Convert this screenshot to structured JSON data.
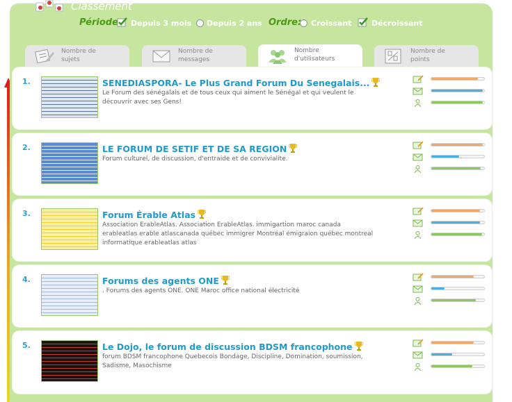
{
  "header": {
    "title": "Classement"
  },
  "filters": {
    "periode_label": "Période:",
    "periode_options": [
      {
        "label": "Depuis 3 mois",
        "selected": true
      },
      {
        "label": "Depuis 2 ans",
        "selected": false
      }
    ],
    "ordre_label": "Ordre:",
    "ordre_options": [
      {
        "label": "Croissant",
        "selected": false
      },
      {
        "label": "Décroissant",
        "selected": true
      }
    ]
  },
  "tabs": [
    {
      "label": "Nombre de sujets",
      "icon": "edit-note-icon",
      "active": false
    },
    {
      "label": "Nombre de messages",
      "icon": "envelope-icon",
      "active": false
    },
    {
      "label": "Nombre d'utilisateurs",
      "icon": "users-icon",
      "active": true
    },
    {
      "label": "Nombre de points",
      "icon": "score-10-10-icon",
      "active": false
    }
  ],
  "forums": [
    {
      "rank": "1.",
      "name": "SENEDIASPORA- Le Plus Grand Forum Du Senegalais...",
      "desc_lines": [
        "Le Forum des sénégalais et de tous ceux qui aiment le Sénégal et qui veulent le",
        "découvrir avec ses Gens!"
      ],
      "stats": {
        "sujets": 0.88,
        "messages": 0.98,
        "utilisateurs": 0.98
      }
    },
    {
      "rank": "2.",
      "name": "LE FORUM DE SETIF ET DE SA REGION",
      "desc_lines": [
        "Forum culturel, de discussion, d'entraide et de convivialite."
      ],
      "stats": {
        "sujets": 0.98,
        "messages": 0.52,
        "utilisateurs": 0.94
      }
    },
    {
      "rank": "3.",
      "name": "Forum Érable Atlas",
      "desc_lines": [
        "Association ErableAtlas. Association ErableAtlas. immigartion maroc canada",
        "erableatlas erable atlascanada québec immigrer Montréal émigraion québec montreal",
        "informatique erableatlas atlas"
      ],
      "stats": {
        "sujets": 0.92,
        "messages": 0.92,
        "utilisateurs": 0.96
      }
    },
    {
      "rank": "4.",
      "name": "Forums des agents ONE",
      "desc_lines": [
        ". Forums des agents ONE. ONE Maroc office national électricité"
      ],
      "stats": {
        "sujets": 0.8,
        "messages": 0.25,
        "utilisateurs": 0.84
      }
    },
    {
      "rank": "5.",
      "name": "Le Dojo, le forum de discussion BDSM francophone",
      "desc_lines": [
        "forum BDSM francophone Quebecois Bondage, Discipline, Domination, soumission,",
        "Sadisme, Masochisme"
      ],
      "stats": {
        "sujets": 0.8,
        "messages": 0.4,
        "utilisateurs": 0.78
      }
    }
  ],
  "colors": {
    "panel": "#c6e6a0",
    "link": "#1f9acc",
    "bar_sujets": "#f0a868",
    "bar_messages": "#48b0e0",
    "bar_utilisateurs": "#8cc860"
  }
}
